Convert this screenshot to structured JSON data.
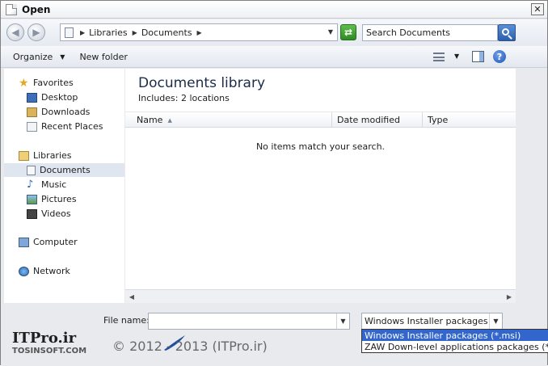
{
  "window": {
    "title": "Open",
    "close_label": "✕"
  },
  "address": {
    "crumbs": [
      "Libraries",
      "Documents"
    ],
    "search_placeholder": "Search Documents"
  },
  "toolbar": {
    "organize_label": "Organize",
    "new_folder_label": "New folder",
    "help_label": "?"
  },
  "sidebar": {
    "favorites_label": "Favorites",
    "favorites": [
      "Desktop",
      "Downloads",
      "Recent Places"
    ],
    "libraries_label": "Libraries",
    "libraries": [
      "Documents",
      "Music",
      "Pictures",
      "Videos"
    ],
    "computer_label": "Computer",
    "network_label": "Network",
    "selected": "Documents"
  },
  "content": {
    "title": "Documents library",
    "includes_label": "Includes:",
    "includes_value": "2 locations",
    "columns": [
      "Name",
      "Date modified",
      "Type"
    ],
    "empty_message": "No items match your search."
  },
  "bottom": {
    "file_name_label": "File name:",
    "file_name_value": "",
    "file_type_selected": "Windows Installer packages (*.r",
    "file_type_options": [
      "Windows Installer packages (*.msi)",
      "ZAW Down-level applications packages (*.zap)"
    ]
  },
  "watermark": {
    "logo": "ITPro.ir",
    "sub": "TOSINSOFT.COM",
    "copyright": "© 2012 - 2013 (ITPro.ir)"
  },
  "colors": {
    "accent": "#3366cc",
    "selection": "#dfe6f0",
    "refresh": "#2e8a24"
  }
}
